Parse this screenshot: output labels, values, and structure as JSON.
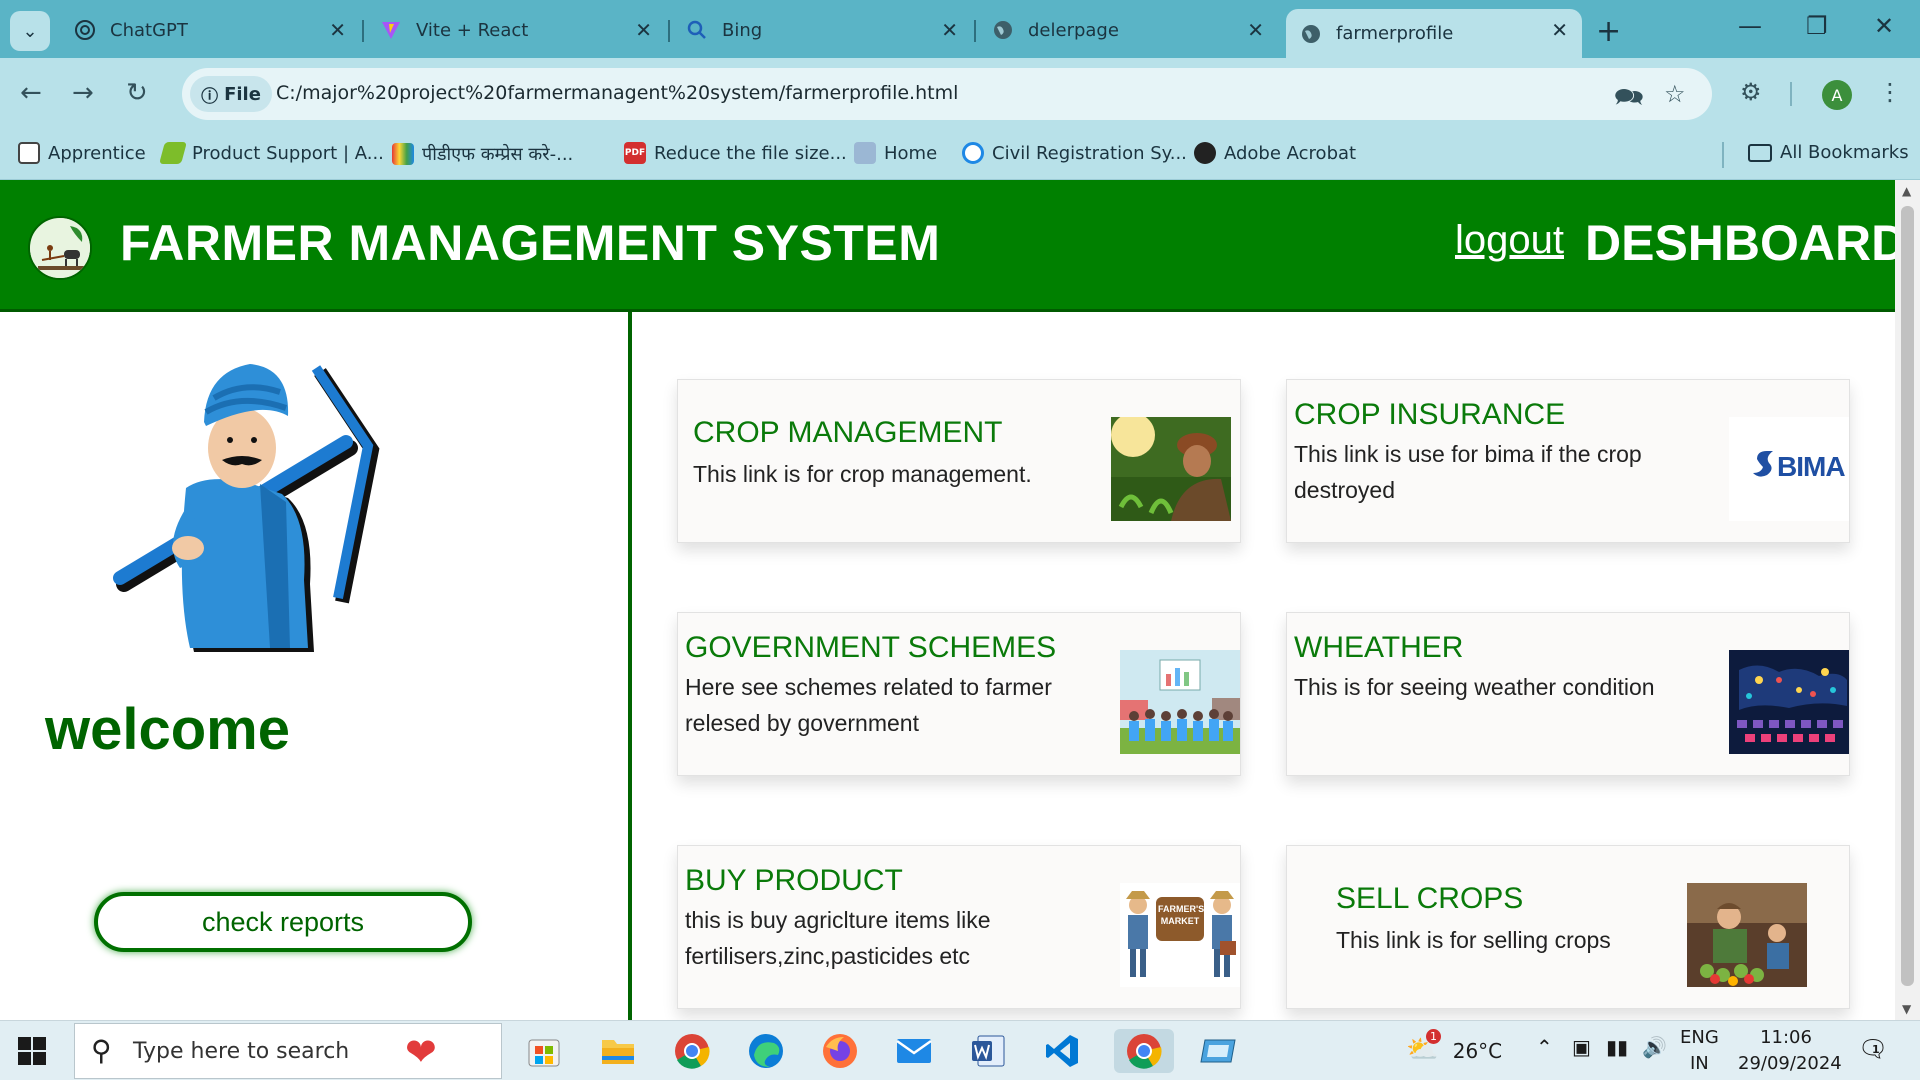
{
  "browser": {
    "tabs": [
      {
        "title": "ChatGPT",
        "icon": "chatgpt-icon"
      },
      {
        "title": "Vite + React",
        "icon": "vite-icon"
      },
      {
        "title": "Bing",
        "icon": "search-icon"
      },
      {
        "title": "delerpage",
        "icon": "globe-icon"
      },
      {
        "title": "farmerprofile",
        "icon": "globe-icon",
        "active": true
      }
    ],
    "url_chip": "File",
    "url": "C:/major%20project%20farmermanagent%20system/farmerprofile.html",
    "profile_initial": "A",
    "bookmarks": [
      "Apprentice",
      "Product Support | A...",
      "पीडीएफ कम्प्रेस करे-...",
      "Reduce the file size...",
      "Home",
      "Civil Registration Sy...",
      "Adobe Acrobat"
    ],
    "all_bookmarks": "All Bookmarks"
  },
  "header": {
    "title": "FARMER MANAGEMENT SYSTEM",
    "logout": "logout",
    "dashboard": "DESHBOARD"
  },
  "sidebar": {
    "welcome": "welcome",
    "check_reports": "check reports"
  },
  "cards": [
    {
      "title": "CROP MANAGEMENT",
      "desc": "This link is for crop management."
    },
    {
      "title": "CROP INSURANCE",
      "desc": "This link is use for bima if the crop destroyed",
      "logo_text": "BIMA"
    },
    {
      "title": "GOVERNMENT SCHEMES",
      "desc": "Here see schemes related to farmer relesed by government"
    },
    {
      "title": "WHEATHER",
      "desc": "This is for seeing weather condition"
    },
    {
      "title": "BUY PRODUCT",
      "desc": "this is buy agriclture items like fertilisers,zinc,pasticides etc",
      "image_text": "FARMER'S MARKET"
    },
    {
      "title": "SELL CROPS",
      "desc": "This link is for selling crops"
    }
  ],
  "taskbar": {
    "search_placeholder": "Type here to search",
    "weather_badge": "1",
    "temperature": "26°C",
    "lang_line1": "ENG",
    "lang_line2": "IN",
    "time": "11:06",
    "date": "29/09/2024",
    "notifications": "1"
  },
  "colors": {
    "header_green": "#008000",
    "title_green": "#0a7a0a",
    "tabbar": "#5ab4c6"
  }
}
